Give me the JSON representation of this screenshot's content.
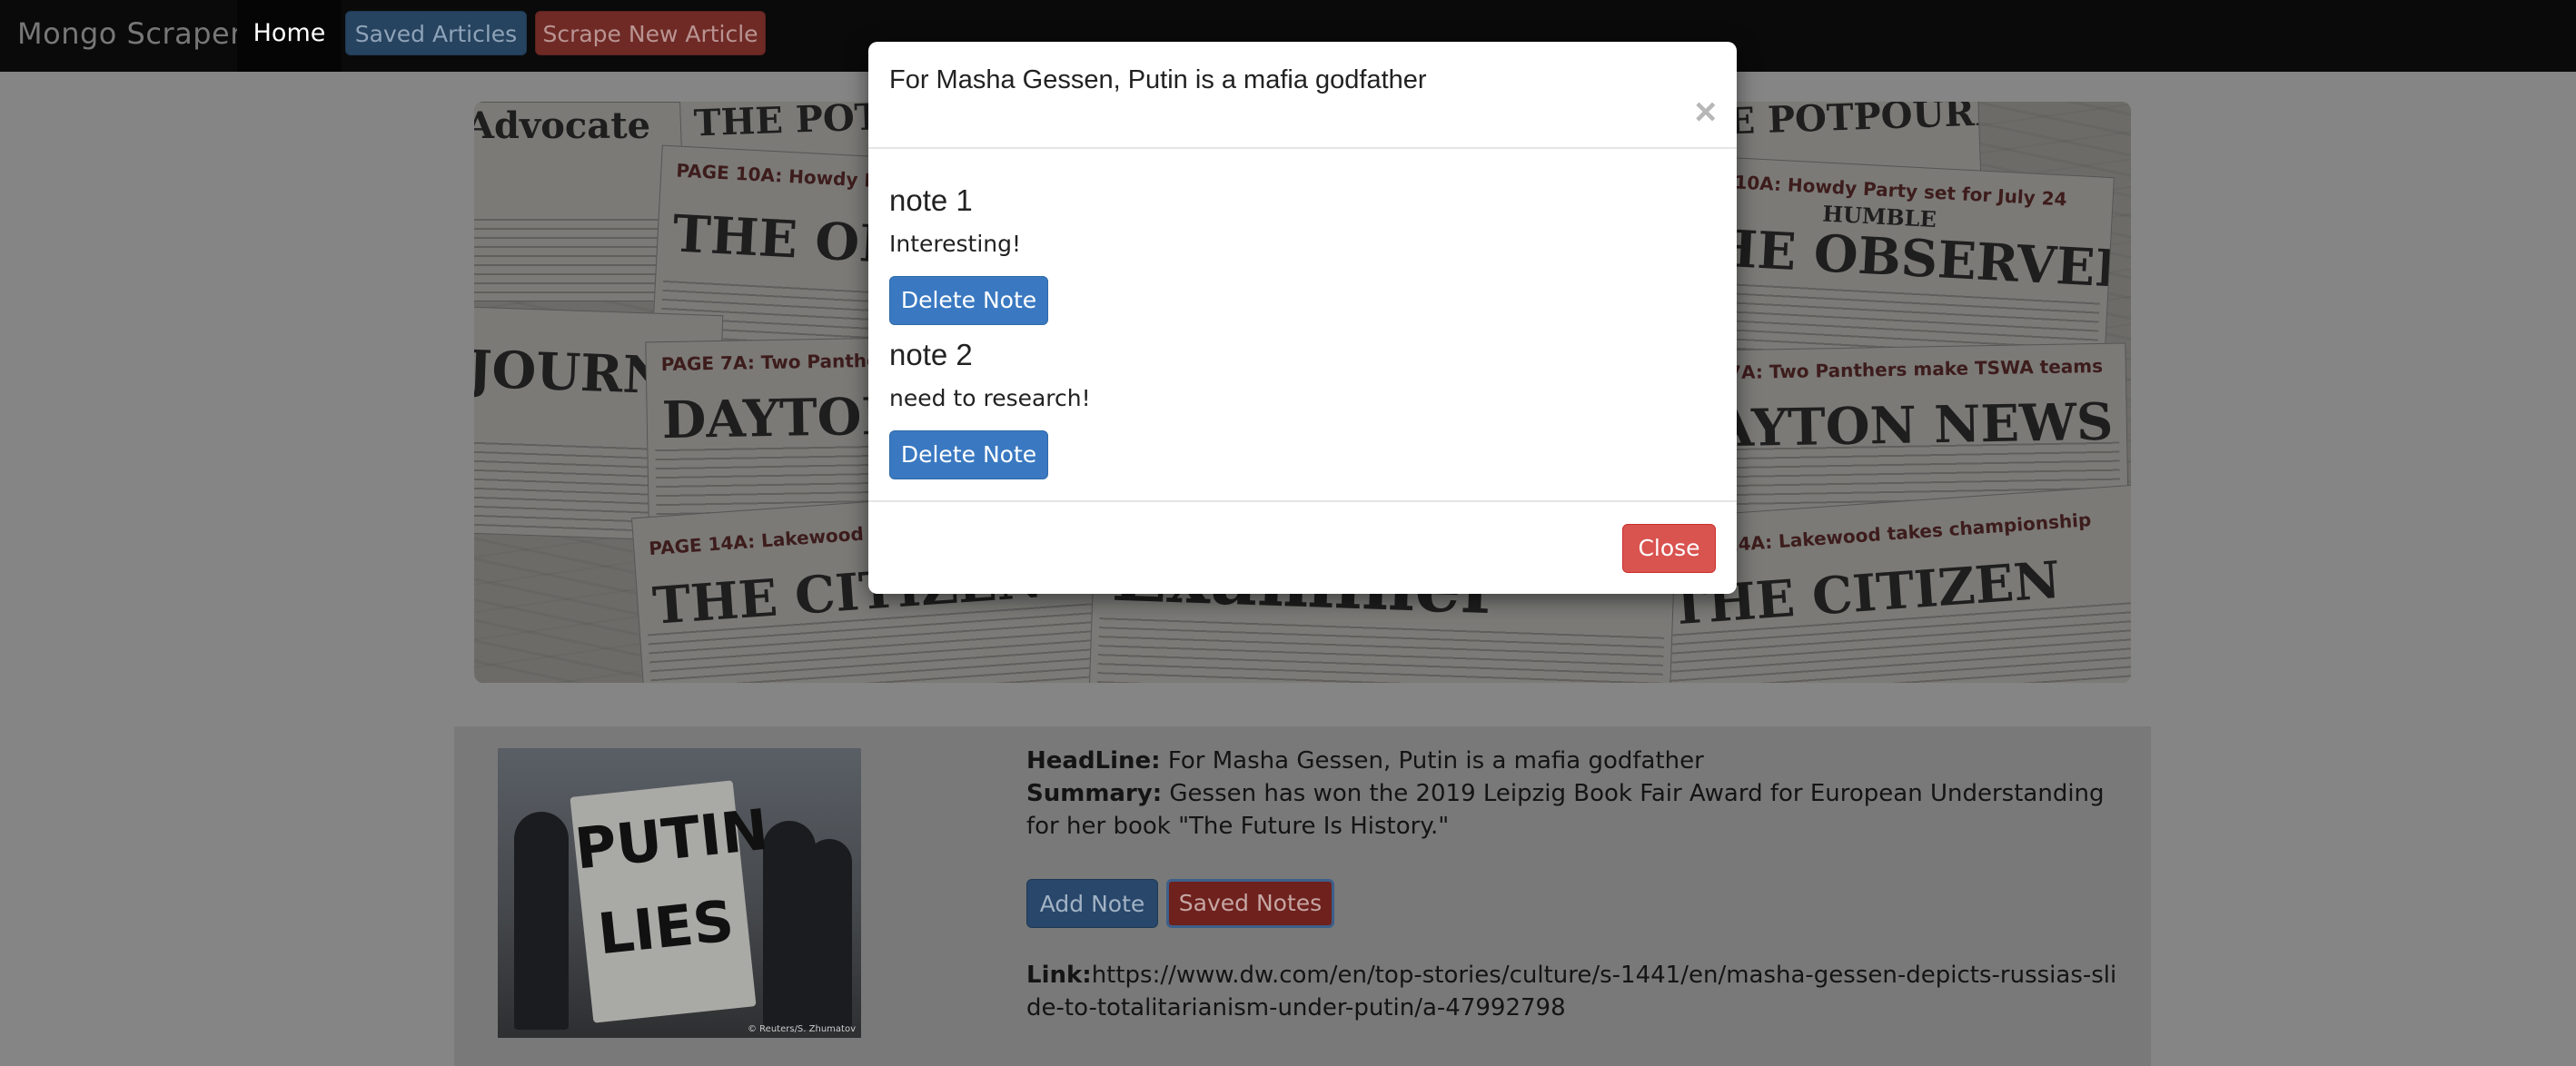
{
  "navbar": {
    "brand": "Mongo Scraper",
    "home_label": "Home",
    "saved_articles_label": "Saved Articles",
    "scrape_label": "Scrape New Article"
  },
  "banner": {
    "papers": [
      "Advocate",
      "THE POTPOURRI",
      "THE OBSERVER",
      "DAYTON NEWS",
      "THE CITIZEN",
      "Examiner",
      "JOURNAL",
      "HUMBLE"
    ],
    "kickers": [
      "PAGE 10A: Howdy Party set for July 24",
      "PAGE 7A: Two Panthers make TSWA teams",
      "PAGE 14A: Lakewood takes championship"
    ]
  },
  "article": {
    "headline_label": "HeadLine:",
    "headline": "For Masha Gessen, Putin is a mafia godfather",
    "summary_label": "Summary:",
    "summary": "Gessen has won the 2019 Leipzig Book Fair Award for European Understanding for her book \"The Future Is History.\"",
    "add_note_label": "Add Note",
    "saved_notes_label": "Saved Notes",
    "link_label": "Link:",
    "link": "https://www.dw.com/en/top-stories/culture/s-1441/en/masha-gessen-depicts-russias-slide-to-totalitarianism-under-putin/a-47992798",
    "image_sign_text": "PUTIN LIES",
    "image_credit": "© Reuters/S. Zhumatov"
  },
  "modal": {
    "title": "For Masha Gessen, Putin is a mafia godfather",
    "close_x": "×",
    "notes": [
      {
        "title": "note 1",
        "body": "Interesting!",
        "delete_label": "Delete Note"
      },
      {
        "title": "note 2",
        "body": "need to research!",
        "delete_label": "Delete Note"
      }
    ],
    "close_label": "Close"
  }
}
